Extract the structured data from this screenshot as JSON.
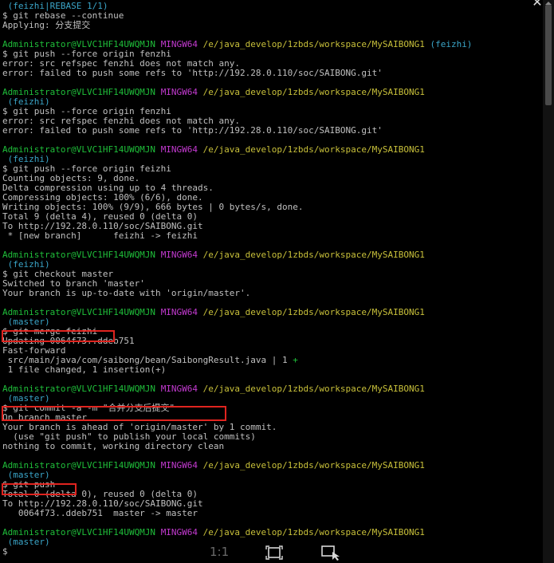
{
  "terminal": {
    "lines": [
      [
        {
          "t": " (feizhi|REBASE 1/1)",
          "c": "cyan"
        }
      ],
      [
        {
          "t": "$ git rebase --continue",
          "c": "white"
        }
      ],
      [
        {
          "t": "Applying: 分支提交",
          "c": "white"
        }
      ],
      [
        {
          "t": "",
          "c": "white"
        }
      ],
      [
        {
          "t": "Administrator@VLVC1HF14UWQMJN ",
          "c": "green"
        },
        {
          "t": "MINGW64 ",
          "c": "magenta"
        },
        {
          "t": "/e/java_develop/1zbds/workspace/MySAIBONG1 ",
          "c": "yellow"
        },
        {
          "t": "(feizhi)",
          "c": "cyan"
        }
      ],
      [
        {
          "t": "$ git push --force origin fenzhi",
          "c": "white"
        }
      ],
      [
        {
          "t": "error: src refspec fenzhi does not match any.",
          "c": "white"
        }
      ],
      [
        {
          "t": "error: failed to push some refs to 'http://192.28.0.110/soc/SAIBONG.git'",
          "c": "white"
        }
      ],
      [
        {
          "t": "",
          "c": "white"
        }
      ],
      [
        {
          "t": "Administrator@VLVC1HF14UWQMJN ",
          "c": "green"
        },
        {
          "t": "MINGW64 ",
          "c": "magenta"
        },
        {
          "t": "/e/java_develop/1zbds/workspace/MySAIBONG1",
          "c": "yellow"
        }
      ],
      [
        {
          "t": " (feizhi)",
          "c": "cyan"
        }
      ],
      [
        {
          "t": "$ git push --force origin fenzhi",
          "c": "white"
        }
      ],
      [
        {
          "t": "error: src refspec fenzhi does not match any.",
          "c": "white"
        }
      ],
      [
        {
          "t": "error: failed to push some refs to 'http://192.28.0.110/soc/SAIBONG.git'",
          "c": "white"
        }
      ],
      [
        {
          "t": "",
          "c": "white"
        }
      ],
      [
        {
          "t": "Administrator@VLVC1HF14UWQMJN ",
          "c": "green"
        },
        {
          "t": "MINGW64 ",
          "c": "magenta"
        },
        {
          "t": "/e/java_develop/1zbds/workspace/MySAIBONG1",
          "c": "yellow"
        }
      ],
      [
        {
          "t": " (feizhi)",
          "c": "cyan"
        }
      ],
      [
        {
          "t": "$ git push --force origin feizhi",
          "c": "white"
        }
      ],
      [
        {
          "t": "Counting objects: 9, done.",
          "c": "white"
        }
      ],
      [
        {
          "t": "Delta compression using up to 4 threads.",
          "c": "white"
        }
      ],
      [
        {
          "t": "Compressing objects: 100% (6/6), done.",
          "c": "white"
        }
      ],
      [
        {
          "t": "Writing objects: 100% (9/9), 666 bytes | 0 bytes/s, done.",
          "c": "white"
        }
      ],
      [
        {
          "t": "Total 9 (delta 4), reused 0 (delta 0)",
          "c": "white"
        }
      ],
      [
        {
          "t": "To http://192.28.0.110/soc/SAIBONG.git",
          "c": "white"
        }
      ],
      [
        {
          "t": " * [new branch]      feizhi -> feizhi",
          "c": "white"
        }
      ],
      [
        {
          "t": "",
          "c": "white"
        }
      ],
      [
        {
          "t": "Administrator@VLVC1HF14UWQMJN ",
          "c": "green"
        },
        {
          "t": "MINGW64 ",
          "c": "magenta"
        },
        {
          "t": "/e/java_develop/1zbds/workspace/MySAIBONG1",
          "c": "yellow"
        }
      ],
      [
        {
          "t": " (feizhi)",
          "c": "cyan"
        }
      ],
      [
        {
          "t": "$ git checkout master",
          "c": "white"
        }
      ],
      [
        {
          "t": "Switched to branch 'master'",
          "c": "white"
        }
      ],
      [
        {
          "t": "Your branch is up-to-date with 'origin/master'.",
          "c": "white"
        }
      ],
      [
        {
          "t": "",
          "c": "white"
        }
      ],
      [
        {
          "t": "Administrator@VLVC1HF14UWQMJN ",
          "c": "green"
        },
        {
          "t": "MINGW64 ",
          "c": "magenta"
        },
        {
          "t": "/e/java_develop/1zbds/workspace/MySAIBONG1",
          "c": "yellow"
        }
      ],
      [
        {
          "t": " (master)",
          "c": "cyan"
        }
      ],
      [
        {
          "t": "$ git merge feizhi",
          "c": "white"
        }
      ],
      [
        {
          "t": "Updating 0064f73..ddeb751",
          "c": "white"
        }
      ],
      [
        {
          "t": "Fast-forward",
          "c": "white"
        }
      ],
      [
        {
          "t": " src/main/java/com/saibong/bean/SaibongResult.java | 1 ",
          "c": "white"
        },
        {
          "t": "+",
          "c": "green"
        }
      ],
      [
        {
          "t": " 1 file changed, 1 insertion(+)",
          "c": "white"
        }
      ],
      [
        {
          "t": "",
          "c": "white"
        }
      ],
      [
        {
          "t": "Administrator@VLVC1HF14UWQMJN ",
          "c": "green"
        },
        {
          "t": "MINGW64 ",
          "c": "magenta"
        },
        {
          "t": "/e/java_develop/1zbds/workspace/MySAIBONG1",
          "c": "yellow"
        }
      ],
      [
        {
          "t": " (master)",
          "c": "cyan"
        }
      ],
      [
        {
          "t": "$ git commit -a -m \"合并分支后提交\"",
          "c": "white"
        }
      ],
      [
        {
          "t": "On branch master",
          "c": "white"
        }
      ],
      [
        {
          "t": "Your branch is ahead of 'origin/master' by 1 commit.",
          "c": "white"
        }
      ],
      [
        {
          "t": "  (use \"git push\" to publish your local commits)",
          "c": "white"
        }
      ],
      [
        {
          "t": "nothing to commit, working directory clean",
          "c": "white"
        }
      ],
      [
        {
          "t": "",
          "c": "white"
        }
      ],
      [
        {
          "t": "Administrator@VLVC1HF14UWQMJN ",
          "c": "green"
        },
        {
          "t": "MINGW64 ",
          "c": "magenta"
        },
        {
          "t": "/e/java_develop/1zbds/workspace/MySAIBONG1",
          "c": "yellow"
        }
      ],
      [
        {
          "t": " (master)",
          "c": "cyan"
        }
      ],
      [
        {
          "t": "$ git push",
          "c": "white"
        }
      ],
      [
        {
          "t": "Total 0 (delta 0), reused 0 (delta 0)",
          "c": "white"
        }
      ],
      [
        {
          "t": "To http://192.28.0.110/soc/SAIBONG.git",
          "c": "white"
        }
      ],
      [
        {
          "t": "   0064f73..ddeb751  master -> master",
          "c": "white"
        }
      ],
      [
        {
          "t": "",
          "c": "white"
        }
      ],
      [
        {
          "t": "Administrator@VLVC1HF14UWQMJN ",
          "c": "green"
        },
        {
          "t": "MINGW64 ",
          "c": "magenta"
        },
        {
          "t": "/e/java_develop/1zbds/workspace/MySAIBONG1",
          "c": "yellow"
        }
      ],
      [
        {
          "t": " (master)",
          "c": "cyan"
        }
      ],
      [
        {
          "t": "$",
          "c": "white"
        }
      ]
    ],
    "highlighted_commands": [
      "$ git merge feizhi",
      "$ git commit -a -m \"合并分支后提交\"",
      "$ git push"
    ]
  },
  "toolbar": {
    "zoom_label": "1:1",
    "fit_icon": "fit-to-window-icon",
    "select_icon": "selection-icon"
  },
  "window": {
    "close_label": "✕"
  },
  "colors": {
    "background": "#000000",
    "text": "#c0c0c0",
    "user_host": "#1fbf3a",
    "mingw": "#c33ad0",
    "path": "#c8c03a",
    "branch": "#3aa5c8",
    "highlight_box": "#e0241f"
  }
}
